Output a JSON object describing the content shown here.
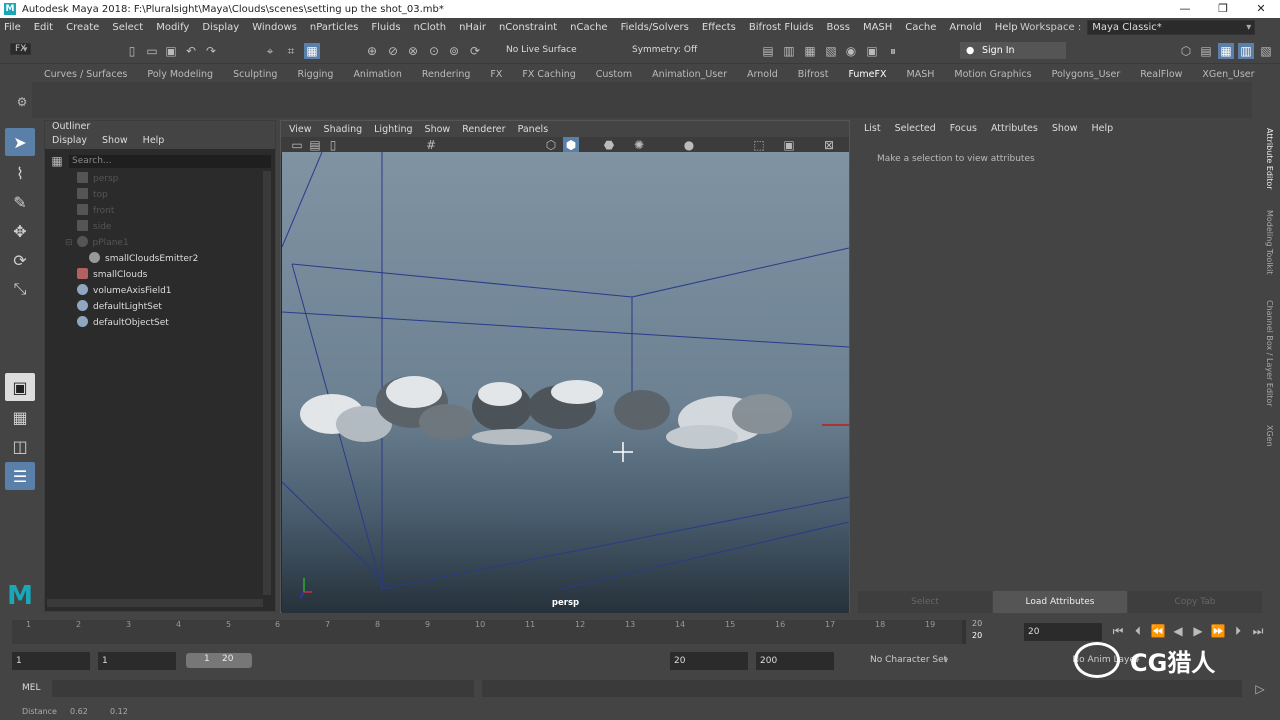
{
  "window": {
    "title": "Autodesk Maya 2018: F:\\Pluralsight\\Maya\\Clouds\\scenes\\setting up the shot_03.mb*",
    "controls": [
      "—",
      "❐",
      "✕"
    ]
  },
  "menubar": {
    "items": [
      "File",
      "Edit",
      "Create",
      "Select",
      "Modify",
      "Display",
      "Windows",
      "nParticles",
      "Fluids",
      "nCloth",
      "nHair",
      "nConstraint",
      "nCache",
      "Fields/Solvers",
      "Effects",
      "Bifrost Fluids",
      "Boss",
      "MASH",
      "Cache",
      "Arnold",
      "Help"
    ],
    "workspace_label": "Workspace :",
    "workspace_value": "Maya Classic*"
  },
  "statusline": {
    "menuset": "FX",
    "live_surface": "No Live Surface",
    "symmetry": "Symmetry: Off",
    "sign_in": "Sign In"
  },
  "shelf": {
    "tabs": [
      "Curves / Surfaces",
      "Poly Modeling",
      "Sculpting",
      "Rigging",
      "Animation",
      "Rendering",
      "FX",
      "FX Caching",
      "Custom",
      "Animation_User",
      "Arnold",
      "Bifrost",
      "FumeFX",
      "MASH",
      "Motion Graphics",
      "Polygons_User",
      "RealFlow",
      "XGen_User"
    ],
    "active_tab": "FumeFX"
  },
  "outliner": {
    "title": "Outliner",
    "menus": [
      "Display",
      "Show",
      "Help"
    ],
    "search_placeholder": "Search...",
    "items": [
      {
        "label": "persp",
        "dim": true,
        "icon": "camera-icon"
      },
      {
        "label": "top",
        "dim": true,
        "icon": "camera-icon"
      },
      {
        "label": "front",
        "dim": true,
        "icon": "camera-icon"
      },
      {
        "label": "side",
        "dim": true,
        "icon": "camera-icon"
      },
      {
        "label": "pPlane1",
        "dim": true,
        "icon": "mesh-icon"
      },
      {
        "label": "smallCloudsEmitter2",
        "dim": false,
        "icon": "emitter-icon"
      },
      {
        "label": "smallClouds",
        "dim": false,
        "icon": "fluid-icon"
      },
      {
        "label": "volumeAxisField1",
        "dim": false,
        "icon": "field-icon"
      },
      {
        "label": "defaultLightSet",
        "dim": false,
        "icon": "set-icon"
      },
      {
        "label": "defaultObjectSet",
        "dim": false,
        "icon": "set-icon"
      }
    ]
  },
  "viewport": {
    "menus": [
      "View",
      "Shading",
      "Lighting",
      "Show",
      "Renderer",
      "Panels"
    ],
    "camera": "persp"
  },
  "attribute_editor": {
    "menus": [
      "List",
      "Selected",
      "Focus",
      "Attributes",
      "Show",
      "Help"
    ],
    "message": "Make a selection to view attributes",
    "buttons": [
      "Select",
      "Load Attributes",
      "Copy Tab"
    ]
  },
  "side_tabs": [
    "Attribute Editor",
    "Modeling Toolkit",
    "Channel Box / Layer Editor",
    "XGen"
  ],
  "timeline": {
    "ticks": [
      "1",
      "2",
      "3",
      "4",
      "5",
      "6",
      "7",
      "8",
      "9",
      "10",
      "11",
      "12",
      "13",
      "14",
      "15",
      "16",
      "17",
      "18",
      "19",
      "20"
    ],
    "current_frame": "20",
    "end_marker_top": "20",
    "end_marker_bottom": "20"
  },
  "range": {
    "start": "1",
    "playback_start": "1",
    "slider_start": "1",
    "slider_end": "20",
    "playback_end": "20",
    "end": "200",
    "character_set": "No Character Set",
    "anim_layer": "No Anim Layer"
  },
  "cmdline": {
    "label": "MEL"
  },
  "helpline": {
    "label": "Distance",
    "v1": "0.62",
    "v2": "0.12"
  },
  "watermark": {
    "text": "CG猎人"
  }
}
